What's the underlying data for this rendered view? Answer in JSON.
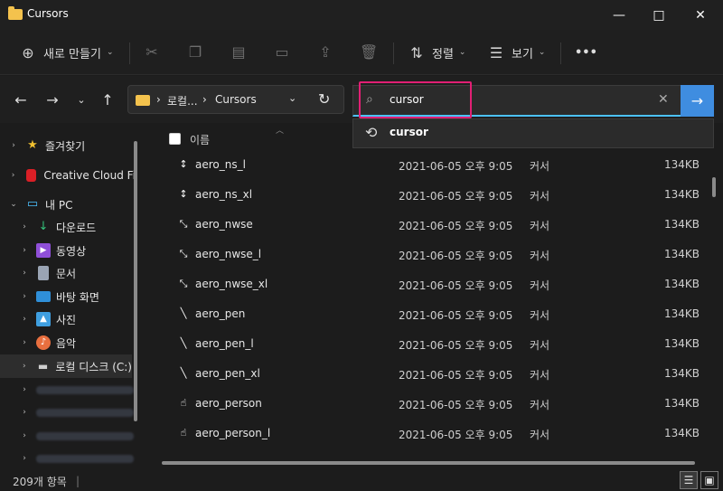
{
  "window": {
    "title": "Cursors"
  },
  "toolbar": {
    "new_label": "새로 만들기",
    "sort_label": "정렬",
    "view_label": "보기",
    "more_label": "•••"
  },
  "address": {
    "overflow": "로컬...",
    "current": "Cursors",
    "separator": "›"
  },
  "search": {
    "value": "cursor",
    "suggestion": "cursor"
  },
  "sidebar": {
    "items": [
      {
        "label": "즐겨찾기",
        "icon": "star-icon",
        "expand": "›"
      },
      {
        "label": "Creative Cloud Fi",
        "icon": "creative-cloud-icon",
        "expand": "›"
      },
      {
        "label": "내 PC",
        "icon": "pc-icon",
        "expand": "⌄"
      },
      {
        "label": "다운로드",
        "icon": "download-icon",
        "expand": "›"
      },
      {
        "label": "동영상",
        "icon": "video-icon",
        "expand": "›"
      },
      {
        "label": "문서",
        "icon": "document-icon",
        "expand": "›"
      },
      {
        "label": "바탕 화면",
        "icon": "desktop-icon",
        "expand": "›"
      },
      {
        "label": "사진",
        "icon": "pictures-icon",
        "expand": "›"
      },
      {
        "label": "음악",
        "icon": "music-icon",
        "expand": "›"
      },
      {
        "label": "로컬 디스크 (C:)",
        "icon": "drive-icon",
        "expand": "›"
      }
    ]
  },
  "filelist": {
    "header_name": "이름",
    "rows": [
      {
        "name": "aero_ns_l",
        "date": "2021-06-05 오후 9:05",
        "type": "커서",
        "size": "134KB",
        "icon": "↕"
      },
      {
        "name": "aero_ns_xl",
        "date": "2021-06-05 오후 9:05",
        "type": "커서",
        "size": "134KB",
        "icon": "↕"
      },
      {
        "name": "aero_nwse",
        "date": "2021-06-05 오후 9:05",
        "type": "커서",
        "size": "134KB",
        "icon": "⤡"
      },
      {
        "name": "aero_nwse_l",
        "date": "2021-06-05 오후 9:05",
        "type": "커서",
        "size": "134KB",
        "icon": "⤡"
      },
      {
        "name": "aero_nwse_xl",
        "date": "2021-06-05 오후 9:05",
        "type": "커서",
        "size": "134KB",
        "icon": "⤡"
      },
      {
        "name": "aero_pen",
        "date": "2021-06-05 오후 9:05",
        "type": "커서",
        "size": "134KB",
        "icon": "╲"
      },
      {
        "name": "aero_pen_l",
        "date": "2021-06-05 오후 9:05",
        "type": "커서",
        "size": "134KB",
        "icon": "╲"
      },
      {
        "name": "aero_pen_xl",
        "date": "2021-06-05 오후 9:05",
        "type": "커서",
        "size": "134KB",
        "icon": "╲"
      },
      {
        "name": "aero_person",
        "date": "2021-06-05 오후 9:05",
        "type": "커서",
        "size": "134KB",
        "icon": "☝"
      },
      {
        "name": "aero_person_l",
        "date": "2021-06-05 오후 9:05",
        "type": "커서",
        "size": "134KB",
        "icon": "☝"
      }
    ]
  },
  "status": {
    "count": "209개 항목",
    "divider": "|"
  }
}
